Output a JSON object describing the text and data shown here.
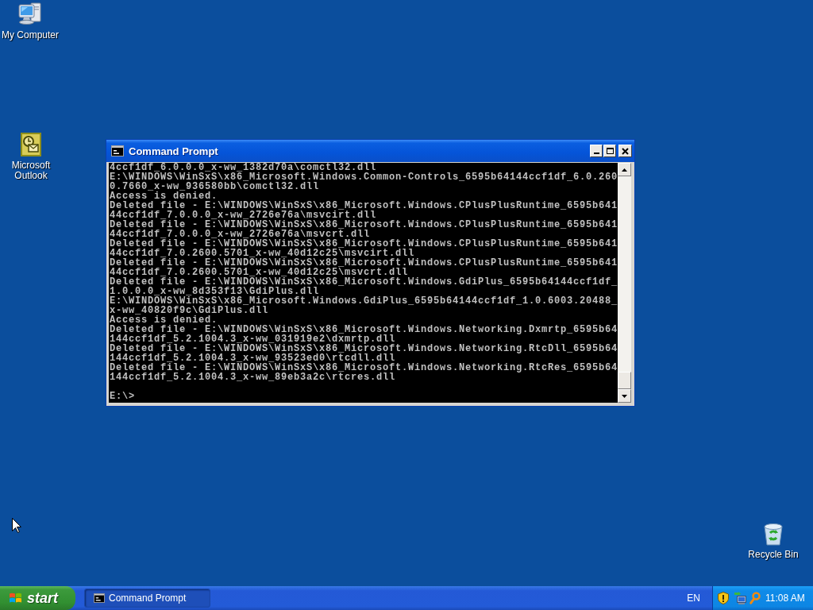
{
  "desktop": {
    "icons": [
      {
        "label": "My Computer",
        "kind": "computer"
      },
      {
        "label": "Microsoft Outlook",
        "kind": "outlook"
      },
      {
        "label": "Recycle Bin",
        "kind": "recycle_bin"
      }
    ]
  },
  "window": {
    "title": "Command Prompt",
    "lines": [
      "4ccf1df_6.0.0.0_x-ww_1382d70a\\comctl32.dll",
      "E:\\WINDOWS\\WinSxS\\x86_Microsoft.Windows.Common-Controls_6595b64144ccf1df_6.0.260",
      "0.7660_x-ww_936580bb\\comctl32.dll",
      "Access is denied.",
      "Deleted file - E:\\WINDOWS\\WinSxS\\x86_Microsoft.Windows.CPlusPlusRuntime_6595b641",
      "44ccf1df_7.0.0.0_x-ww_2726e76a\\msvcirt.dll",
      "Deleted file - E:\\WINDOWS\\WinSxS\\x86_Microsoft.Windows.CPlusPlusRuntime_6595b641",
      "44ccf1df_7.0.0.0_x-ww_2726e76a\\msvcrt.dll",
      "Deleted file - E:\\WINDOWS\\WinSxS\\x86_Microsoft.Windows.CPlusPlusRuntime_6595b641",
      "44ccf1df_7.0.2600.5701_x-ww_40d12c25\\msvcirt.dll",
      "Deleted file - E:\\WINDOWS\\WinSxS\\x86_Microsoft.Windows.CPlusPlusRuntime_6595b641",
      "44ccf1df_7.0.2600.5701_x-ww_40d12c25\\msvcrt.dll",
      "Deleted file - E:\\WINDOWS\\WinSxS\\x86_Microsoft.Windows.GdiPlus_6595b64144ccf1df_",
      "1.0.0.0_x-ww_8d353f13\\GdiPlus.dll",
      "E:\\WINDOWS\\WinSxS\\x86_Microsoft.Windows.GdiPlus_6595b64144ccf1df_1.0.6003.20488_",
      "x-ww_40820f9c\\GdiPlus.dll",
      "Access is denied.",
      "Deleted file - E:\\WINDOWS\\WinSxS\\x86_Microsoft.Windows.Networking.Dxmrtp_6595b64",
      "144ccf1df_5.2.1004.3_x-ww_031919e2\\dxmrtp.dll",
      "Deleted file - E:\\WINDOWS\\WinSxS\\x86_Microsoft.Windows.Networking.RtcDll_6595b64",
      "144ccf1df_5.2.1004.3_x-ww_93523ed0\\rtcdll.dll",
      "Deleted file - E:\\WINDOWS\\WinSxS\\x86_Microsoft.Windows.Networking.RtcRes_6595b64",
      "144ccf1df_5.2.1004.3_x-ww_89eb3a2c\\rtcres.dll"
    ],
    "prompt": "E:\\>"
  },
  "taskbar": {
    "start": "start",
    "tasks": [
      {
        "label": "Command Prompt",
        "selected": true
      }
    ],
    "language": "EN",
    "clock": "11:08 AM"
  }
}
